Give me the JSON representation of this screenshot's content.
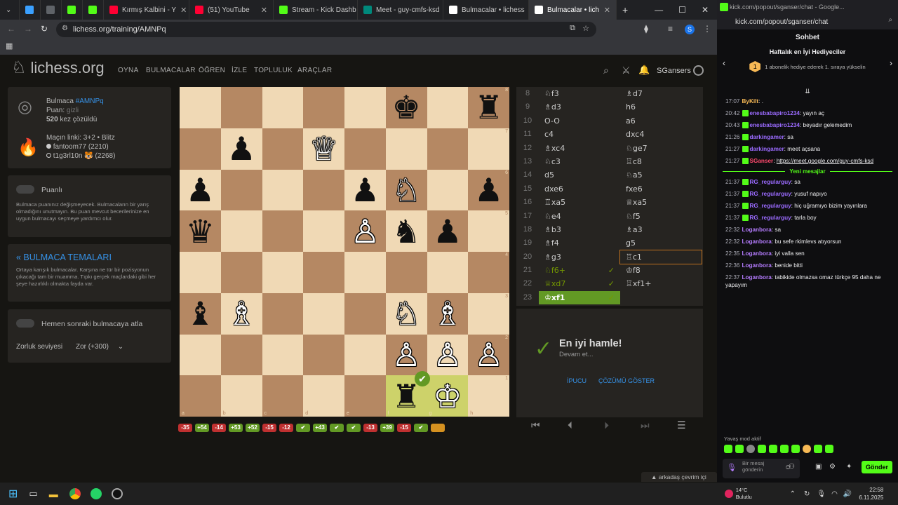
{
  "browser": {
    "tabs": [
      {
        "title": "Kırmış Kalbini - Y",
        "color": "#ff0033"
      },
      {
        "title": "(51) YouTube",
        "color": "#ff0033"
      },
      {
        "title": "Stream - Kick Dashb",
        "color": "#53fc18"
      },
      {
        "title": "Meet - guy-cmfs-ksd",
        "color": "#00897b"
      },
      {
        "title": "Bulmacalar • lichess",
        "color": "#ffffff"
      },
      {
        "title": "Bulmacalar • lich",
        "color": "#ffffff"
      }
    ],
    "url": "lichess.org/training/AMNPq",
    "profile_initial": "S"
  },
  "site": {
    "logo": "lichess.org",
    "nav": [
      "OYNA",
      "BULMACALAR",
      "ÖĞREN",
      "İZLE",
      "TOPLULUK",
      "ARAÇLAR"
    ],
    "user": "SGansers"
  },
  "puzzle": {
    "label": "Bulmaca",
    "id": "#AMNPq",
    "rating_label": "Puan:",
    "rating_value": "gizli",
    "solved_count": "520",
    "solved_text": "kez çözüldü",
    "game_link": "Maçın linki: 3+2 • Blitz",
    "player_white": "fantoom77 (2210)",
    "player_black": "t1g3rl10n 🐯 (2268)"
  },
  "rated": {
    "label": "Puanlı",
    "desc": "Bulmaca puanınız değişmeyecek. Bulmacaların bir yarış olmadığını unutmayın. Bu puan mevcut becerilerinize en uygun bulmacayı seçmeye yardımcı olur."
  },
  "themes": {
    "title": "« BULMACA TEMALARI",
    "desc": "Ortaya karışık bulmacalar. Karşına ne tür bir pozisyonun çıkacağı tam bir muamma. Tıpkı gerçek maçlardaki gibi her şeye hazırlıklı olmakta fayda var."
  },
  "next": {
    "label": "Hemen sonraki bulmacaya atla",
    "difficulty_label": "Zorluk seviyesi",
    "difficulty_value": "Zor (+300)"
  },
  "board": {
    "rows": [
      [
        "",
        "",
        "",
        "",
        "",
        "♚",
        "",
        "♜"
      ],
      [
        "",
        "♟",
        "",
        "♕",
        "",
        "",
        "",
        ""
      ],
      [
        "♟",
        "",
        "",
        "",
        "♟",
        "♘",
        "",
        "♟"
      ],
      [
        "♛",
        "",
        "",
        "",
        "♙",
        "♞",
        "♟",
        ""
      ],
      [
        "",
        "",
        "",
        "",
        "",
        "",
        "",
        ""
      ],
      [
        "♝",
        "♗",
        "",
        "",
        "",
        "♘",
        "♗",
        ""
      ],
      [
        "",
        "",
        "",
        "",
        "",
        "♙",
        "♙",
        "♙"
      ],
      [
        "",
        "",
        "",
        "",
        "",
        "♜",
        "♔",
        ""
      ]
    ],
    "white": [
      [
        "",
        "",
        "",
        "",
        "",
        "",
        "",
        ""
      ],
      [
        "",
        "",
        "",
        "w",
        "",
        "",
        "",
        ""
      ],
      [
        "",
        "",
        "",
        "",
        "",
        "w",
        "",
        ""
      ],
      [
        "",
        "",
        "",
        "",
        "w",
        "",
        "",
        ""
      ],
      [
        "",
        "",
        "",
        "",
        "",
        "",
        "",
        ""
      ],
      [
        "",
        "w",
        "",
        "",
        "",
        "w",
        "w",
        ""
      ],
      [
        "",
        "",
        "",
        "",
        "",
        "w",
        "w",
        "w"
      ],
      [
        "",
        "",
        "",
        "",
        "",
        "",
        "w",
        ""
      ]
    ],
    "files": [
      "a",
      "b",
      "c",
      "d",
      "e",
      "f",
      "g",
      "h"
    ],
    "ranks": [
      "8",
      "7",
      "6",
      "5",
      "4",
      "3",
      "2",
      "1"
    ]
  },
  "moves": [
    {
      "n": "8",
      "w": "♘f3",
      "b": "♗d7"
    },
    {
      "n": "9",
      "w": "♗d3",
      "b": "h6"
    },
    {
      "n": "10",
      "w": "O-O",
      "b": "a6"
    },
    {
      "n": "11",
      "w": "c4",
      "b": "dxc4"
    },
    {
      "n": "12",
      "w": "♗xc4",
      "b": "♘ge7"
    },
    {
      "n": "13",
      "w": "♘c3",
      "b": "♖c8"
    },
    {
      "n": "14",
      "w": "d5",
      "b": "♘a5"
    },
    {
      "n": "15",
      "w": "dxe6",
      "b": "fxe6"
    },
    {
      "n": "16",
      "w": "♖xa5",
      "b": "♕xa5"
    },
    {
      "n": "17",
      "w": "♘e4",
      "b": "♘f5"
    },
    {
      "n": "18",
      "w": "♗b3",
      "b": "♗a3"
    },
    {
      "n": "19",
      "w": "♗f4",
      "b": "g5"
    },
    {
      "n": "20",
      "w": "♗g3",
      "b": "♖c1"
    },
    {
      "n": "21",
      "w": "♘f6+",
      "b": "♔f8"
    },
    {
      "n": "22",
      "w": "♕xd7",
      "b": "♖xf1+"
    },
    {
      "n": "23",
      "w": "♔xf1",
      "b": ""
    }
  ],
  "result": {
    "title": "En iyi hamle!",
    "sub": "Devam et...",
    "hint": "İPUCU",
    "solution": "ÇÖZÜMÜ GÖSTER"
  },
  "history": [
    {
      "t": "-35",
      "c": "#bf3030"
    },
    {
      "t": "+54",
      "c": "#629924"
    },
    {
      "t": "-14",
      "c": "#bf3030"
    },
    {
      "t": "+53",
      "c": "#629924"
    },
    {
      "t": "+52",
      "c": "#629924"
    },
    {
      "t": "-15",
      "c": "#bf3030"
    },
    {
      "t": "-12",
      "c": "#bf3030"
    },
    {
      "t": "✔",
      "c": "#629924"
    },
    {
      "t": "+43",
      "c": "#629924"
    },
    {
      "t": "✔",
      "c": "#629924"
    },
    {
      "t": "✔",
      "c": "#629924"
    },
    {
      "t": "-13",
      "c": "#bf3030"
    },
    {
      "t": "+39",
      "c": "#629924"
    },
    {
      "t": "-15",
      "c": "#bf3030"
    },
    {
      "t": "✔",
      "c": "#629924"
    },
    {
      "t": "",
      "c": "#d59120"
    }
  ],
  "chat": {
    "window_title": "kick.com/popout/sganser/chat - Google...",
    "url": "kick.com/popout/sganser/chat",
    "heading": "Sohbet",
    "gifters_title": "Haftalık en İyi Hediyeciler",
    "gifters_sub": "1 abonelik hediye ederek 1. sıraya yükselin",
    "new_messages": "Yeni mesajlar",
    "messages_old": [
      {
        "t": "17:07",
        "u": "ByKilt",
        "c": "#f7b955",
        "m": "."
      },
      {
        "t": "20:42",
        "u": "enesbabapiro1234",
        "c": "#9b6bff",
        "m": "yayın aç"
      },
      {
        "t": "20:43",
        "u": "enesbabapiro1234",
        "c": "#9b6bff",
        "m": "beyadır gelemedim"
      },
      {
        "t": "21:26",
        "u": "darkingamer",
        "c": "#9b6bff",
        "m": "sa"
      },
      {
        "t": "21:27",
        "u": "darkingamer",
        "c": "#9b6bff",
        "m": "meet açsana"
      },
      {
        "t": "21:27",
        "u": "SGanser",
        "c": "#ff4a6e",
        "m": "https://meet.google.com/guy-cmfs-ksd"
      }
    ],
    "messages_new": [
      {
        "t": "21:37",
        "u": "RG_regularguy",
        "c": "#9b6bff",
        "m": "sa"
      },
      {
        "t": "21:37",
        "u": "RG_regularguy",
        "c": "#9b6bff",
        "m": "yusuf napıyo"
      },
      {
        "t": "21:37",
        "u": "RG_regularguy",
        "c": "#9b6bff",
        "m": "hiç uğramıyo bizim yayınlara"
      },
      {
        "t": "21:37",
        "u": "RG_regularguy",
        "c": "#9b6bff",
        "m": "tarla boy"
      },
      {
        "t": "22:32",
        "u": "Loganbora",
        "c": "#b57cff",
        "m": "sa"
      },
      {
        "t": "22:32",
        "u": "Loganbora",
        "c": "#b57cff",
        "m": "bu sefe rkimlevs atıyorsun"
      },
      {
        "t": "22:35",
        "u": "Loganbora",
        "c": "#b57cff",
        "m": "iyi valla sen"
      },
      {
        "t": "22:36",
        "u": "Loganbora",
        "c": "#b57cff",
        "m": "benide bitti"
      },
      {
        "t": "22:37",
        "u": "Loganbora",
        "c": "#b57cff",
        "m": "tabikide olmazsa omaz türkçe 95 daha ne yapayım"
      }
    ],
    "slow_mode": "Yavaş mod aktif",
    "input_placeholder": "Bir mesaj gönderin",
    "send": "Gönder",
    "friends_online": "arkadaş çevrim içi"
  },
  "taskbar": {
    "weather_temp": "14°C",
    "weather_desc": "Bulutlu",
    "time": "22:58",
    "date": "6.11.2025"
  }
}
